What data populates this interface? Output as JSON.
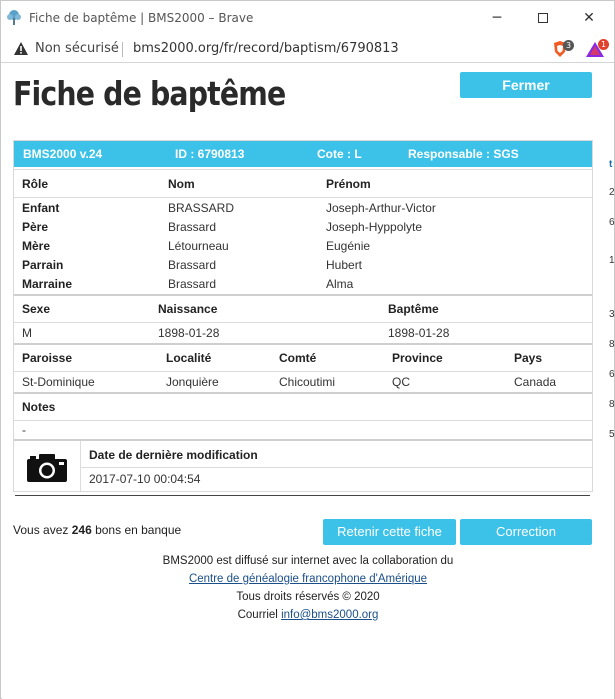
{
  "browser": {
    "title": "Fiche de baptême | BMS2000 – Brave",
    "security": "Non sécurisé",
    "url": "bms2000.org/fr/record/baptism/6790813",
    "shield_badge": "3",
    "rewards_badge": "1"
  },
  "page": {
    "title": "Fiche de baptême",
    "close_label": "Fermer"
  },
  "record": {
    "header": {
      "version": "BMS2000 v.24",
      "id": "ID : 6790813",
      "cote": "Cote : L",
      "responsable": "Responsable : SGS"
    },
    "persons_headers": [
      "Rôle",
      "Nom",
      "Prénom"
    ],
    "persons": [
      {
        "role": "Enfant",
        "nom": "BRASSARD",
        "prenom": "Joseph-Arthur-Victor"
      },
      {
        "role": "Père",
        "nom": "Brassard",
        "prenom": "Joseph-Hyppolyte"
      },
      {
        "role": "Mère",
        "nom": "Létourneau",
        "prenom": "Eugénie"
      },
      {
        "role": "Parrain",
        "nom": "Brassard",
        "prenom": "Hubert"
      },
      {
        "role": "Marraine",
        "nom": "Brassard",
        "prenom": "Alma"
      }
    ],
    "dates_headers": [
      "Sexe",
      "Naissance",
      "Baptême"
    ],
    "dates": {
      "sexe": "M",
      "naissance": "1898-01-28",
      "bapteme": "1898-01-28"
    },
    "place_headers": [
      "Paroisse",
      "Localité",
      "Comté",
      "Province",
      "Pays"
    ],
    "place": {
      "paroisse": "St-Dominique",
      "localite": "Jonquière",
      "comte": "Chicoutimi",
      "province": "QC",
      "pays": "Canada"
    },
    "notes_label": "Notes",
    "notes_value": "-",
    "modified_label": "Date de dernière modification",
    "modified_value": "2017-07-10 00:04:54"
  },
  "bank": {
    "prefix": "Vous avez ",
    "count": "246",
    "suffix": " bons en banque"
  },
  "actions": {
    "retain_label": "Retenir cette fiche",
    "correction_label": "Correction"
  },
  "footer": {
    "line1": "BMS2000 est diffusé sur internet avec la collaboration du",
    "link1": "Centre de généalogie francophone d'Amérique",
    "line3": "Tous droits réservés © 2020",
    "courriel_prefix": "Courriel ",
    "email": "info@bms2000.org"
  },
  "edge_fragments": [
    "t",
    "2",
    "6",
    "1",
    "3",
    "8",
    "6",
    "8",
    "5"
  ],
  "colors": {
    "accent": "#3cc2e8"
  }
}
